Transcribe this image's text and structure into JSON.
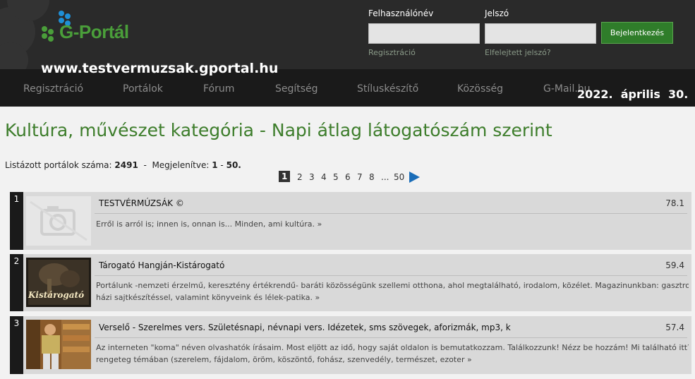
{
  "header": {
    "logo_text": "G-Portál",
    "login": {
      "username_label": "Felhasználónév",
      "password_label": "Jelszó",
      "username_value": "",
      "password_value": "",
      "submit_label": "Bejelentkezés",
      "register_link": "Regisztráció",
      "forgot_link": "Elfelejtett jelszó?"
    },
    "site_url": "www.testvermuzsak.gportal.hu",
    "date": "2022.  április  30."
  },
  "nav": {
    "items": [
      "Regisztráció",
      "Portálok",
      "Fórum",
      "Segítség",
      "Stíluskészítő",
      "Közösség",
      "G-Mail.hu"
    ]
  },
  "main": {
    "title": "Kultúra, művészet kategória - Napi átlag látogatószám szerint",
    "count_label": "Listázott portálok száma:",
    "count_value": "2491",
    "sep": "-",
    "shown_label": "Megjelenítve:",
    "shown_from": "1",
    "shown_dash": "-",
    "shown_to": "50.",
    "pagination": [
      "1",
      "2",
      "3",
      "4",
      "5",
      "6",
      "7",
      "8",
      "...",
      "50"
    ],
    "portals": [
      {
        "rank": "1",
        "name": "TESTVÉRMÚZSÁK ©",
        "score": "78.1",
        "desc_lines": [
          "Erről is arról is; innen is, onnan is... Minden, ami kultúra. »"
        ]
      },
      {
        "rank": "2",
        "name": "Tárogató Hangján-Kistárogató",
        "score": "59.4",
        "thumb_caption": "Kistárogató",
        "desc_lines": [
          "Portálunk -nemzeti érzelmű, keresztény értékrendű- baráti közösségünk szellemi otthona, ahol megtalálható, irodalom, közélet. Magazinunkban: gasztronómia",
          "házi sajtkészítéssel, valamint könyveink és lélek-patika.  »"
        ]
      },
      {
        "rank": "3",
        "name": "Verselő - Szerelmes vers. Születésnapi, névnapi vers. Idézetek, sms szövegek, aforizmák, mp3, k",
        "score": "57.4",
        "desc_lines": [
          "Az interneten \"koma\" néven olvashatók írásaim. Most eljött az idő, hogy saját oldalon is bemutatkozzam. Találkozzunk! Nézz be hozzám! Mi található itt? Vers",
          "rengeteg témában (szerelem, fájdalom, öröm, köszöntő, fohász, szenvedély, természet, ezoter »"
        ]
      }
    ]
  }
}
